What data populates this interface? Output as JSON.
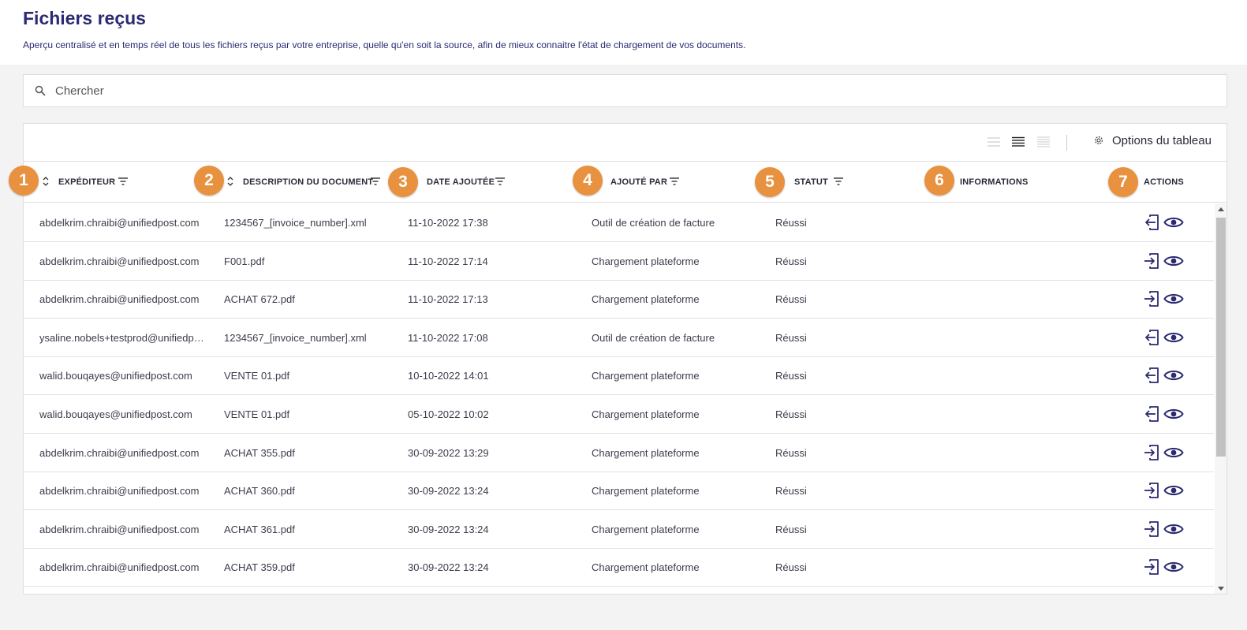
{
  "page": {
    "title": "Fichiers reçus",
    "subtitle": "Aperçu centralisé et en temps réel de tous les fichiers reçus par votre entreprise, quelle qu'en soit la source, afin de mieux connaitre l'état de chargement de vos documents."
  },
  "search": {
    "placeholder": "Chercher",
    "value": ""
  },
  "toolbar": {
    "options_label": "Options du tableau",
    "density_selected": "medium"
  },
  "columns": {
    "sender": "EXPÉDITEUR",
    "description": "DESCRIPTION DU DOCUMENT",
    "date": "DATE AJOUTÉE",
    "added_by": "AJOUTÉ PAR",
    "status": "STATUT",
    "info": "INFORMATIONS",
    "actions": "ACTIONS"
  },
  "badges": [
    "1",
    "2",
    "3",
    "4",
    "5",
    "6",
    "7"
  ],
  "rows": [
    {
      "sender": "abdelkrim.chraibi@unifiedpost.com",
      "description": "1234567_[invoice_number].xml",
      "date": "11-10-2022 17:38",
      "added_by": "Outil de création de facture",
      "status": "Réussi",
      "info": "",
      "load_icon": "file-export-icon"
    },
    {
      "sender": "abdelkrim.chraibi@unifiedpost.com",
      "description": "F001.pdf",
      "date": "11-10-2022 17:14",
      "added_by": "Chargement plateforme",
      "status": "Réussi",
      "info": "",
      "load_icon": "file-import-icon"
    },
    {
      "sender": "abdelkrim.chraibi@unifiedpost.com",
      "description": "ACHAT 672.pdf",
      "date": "11-10-2022 17:13",
      "added_by": "Chargement plateforme",
      "status": "Réussi",
      "info": "",
      "load_icon": "file-import-icon"
    },
    {
      "sender": "ysaline.nobels+testprod@unifiedpost.com",
      "description": "1234567_[invoice_number].xml",
      "date": "11-10-2022 17:08",
      "added_by": "Outil de création de facture",
      "status": "Réussi",
      "info": "",
      "load_icon": "file-export-icon"
    },
    {
      "sender": "walid.bouqayes@unifiedpost.com",
      "description": "VENTE 01.pdf",
      "date": "10-10-2022 14:01",
      "added_by": "Chargement plateforme",
      "status": "Réussi",
      "info": "",
      "load_icon": "file-export-icon"
    },
    {
      "sender": "walid.bouqayes@unifiedpost.com",
      "description": "VENTE 01.pdf",
      "date": "05-10-2022 10:02",
      "added_by": "Chargement plateforme",
      "status": "Réussi",
      "info": "",
      "load_icon": "file-export-icon"
    },
    {
      "sender": "abdelkrim.chraibi@unifiedpost.com",
      "description": "ACHAT 355.pdf",
      "date": "30-09-2022 13:29",
      "added_by": "Chargement plateforme",
      "status": "Réussi",
      "info": "",
      "load_icon": "file-import-icon"
    },
    {
      "sender": "abdelkrim.chraibi@unifiedpost.com",
      "description": "ACHAT 360.pdf",
      "date": "30-09-2022 13:24",
      "added_by": "Chargement plateforme",
      "status": "Réussi",
      "info": "",
      "load_icon": "file-import-icon"
    },
    {
      "sender": "abdelkrim.chraibi@unifiedpost.com",
      "description": "ACHAT 361.pdf",
      "date": "30-09-2022 13:24",
      "added_by": "Chargement plateforme",
      "status": "Réussi",
      "info": "",
      "load_icon": "file-import-icon"
    },
    {
      "sender": "abdelkrim.chraibi@unifiedpost.com",
      "description": "ACHAT 359.pdf",
      "date": "30-09-2022 13:24",
      "added_by": "Chargement plateforme",
      "status": "Réussi",
      "info": "",
      "load_icon": "file-import-icon"
    }
  ],
  "colors": {
    "accent": "#2b2a73",
    "badge": "#e8913f",
    "border": "#dedede"
  }
}
